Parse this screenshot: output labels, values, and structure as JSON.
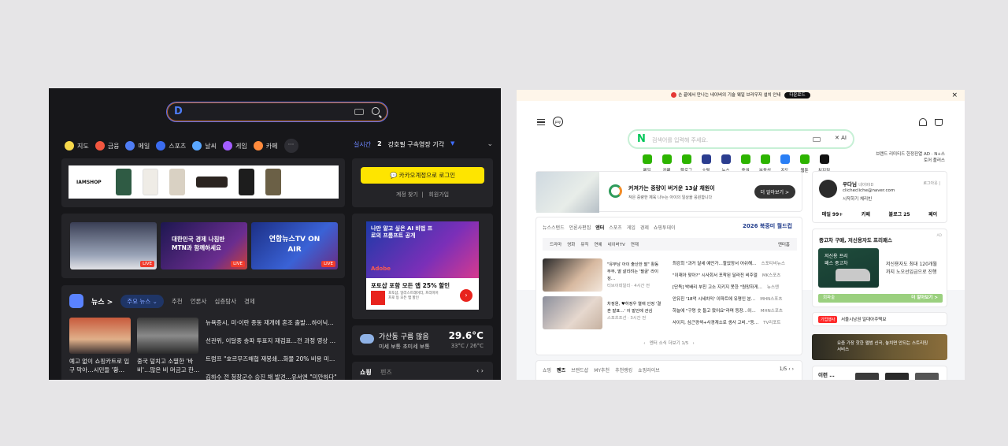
{
  "daum": {
    "search": {
      "placeholder": ""
    },
    "categories": [
      {
        "label": "지도",
        "color": "#f6d84b",
        "icon": "map-icon"
      },
      {
        "label": "금융",
        "color": "#f2563f",
        "icon": "finance-icon"
      },
      {
        "label": "메일",
        "color": "#4f7df5",
        "icon": "mail-icon"
      },
      {
        "label": "스포츠",
        "color": "#3b6cf0",
        "icon": "sports-icon"
      },
      {
        "label": "날씨",
        "color": "#5aa7ff",
        "icon": "weather-icon"
      },
      {
        "label": "게임",
        "color": "#a35dff",
        "icon": "game-icon"
      },
      {
        "label": "카페",
        "color": "#ff8a3c",
        "icon": "cafe-icon"
      }
    ],
    "more_label": "···",
    "realtime": {
      "label": "실시간",
      "rank": "2",
      "keyword": "강호필 구속영장 기각",
      "trend": "▼"
    },
    "ad_brand": "IAMSHOP",
    "login": {
      "button": "카카오계정으로 로그인",
      "find": "계정 찾기",
      "signup": "회원가입"
    },
    "videos": [
      {
        "live": "LIVE",
        "title": ""
      },
      {
        "live": "LIVE",
        "title": "대한민국 경제 나침반 MTN과 함께하세요"
      },
      {
        "live": "LIVE",
        "title": "연합뉴스TV ON AIR"
      }
    ],
    "side_ad": {
      "headline": "나만 알고 싶은 AI 비법 프로의 프롬프트 공개",
      "brand": "Adobe",
      "offer": "포토샵 포함 모든 앱 25% 할인",
      "detail": "포토샵, 일러스트레이터, 프리미어 프로 등 모든 앱 할인"
    },
    "news": {
      "section": "뉴스 >",
      "tabs": [
        "주요 뉴스",
        "추천",
        "언론사",
        "심층탐사",
        "경제"
      ],
      "thumb_caps": [
        "예고 없이 쇼핑카트로 입구 막아…시민들 '황…",
        "중국 덮치고 소멸한 '바비'…많은 비 머금고 한…"
      ],
      "headlines": [
        "뉴욕증시, 미·이란 종동 재개에 혼조 출발…하이닉…",
        "선관위, 이달중 송파 투표지 재검표…전 과정 영상 …",
        "트럼프 \"호르무즈해협 재봉쇄…화물 20% 비용 미…",
        "김하수 전 청장군수 승진 채 발견…유서엔 \"미안하다\""
      ]
    },
    "weather": {
      "location": "가산동 구름 많음",
      "dust": "미세 보통   초미세 보통",
      "temp": "29.6°C",
      "range": "33°C / 26°C"
    },
    "shop": {
      "label": "쇼핑",
      "sub": "펜즈",
      "nav": "‹  ›"
    }
  },
  "naver": {
    "banner": {
      "text": "손 끝에서 만나는 네이버의 기술 웨일 브라우저 설치 안내",
      "download": "다운로드",
      "close": "×"
    },
    "search": {
      "placeholder": "검색어를 입력해 주세요.",
      "ai": "✕ AI"
    },
    "services": [
      {
        "label": "메일",
        "color": "#2db400"
      },
      {
        "label": "카페",
        "color": "#2db400"
      },
      {
        "label": "블로그",
        "color": "#2db400"
      },
      {
        "label": "쇼핑",
        "color": "#2b3d8f"
      },
      {
        "label": "뉴스",
        "color": "#2b3d8f"
      },
      {
        "label": "증권",
        "color": "#2db400"
      },
      {
        "label": "부동산",
        "color": "#2db400"
      },
      {
        "label": "지도",
        "color": "#2a7ff5"
      },
      {
        "label": "웹툰",
        "color": "#2db400"
      },
      {
        "label": "치지직",
        "color": "#111111"
      }
    ],
    "promo": "브랜드 리미티드 한정진열 AD · N+스토어 플러스",
    "ad": {
      "title": "커져가는 중량이 버거운 13살 채원이",
      "desc": "작은 중량한 체육 나누는 아이의 일상을 응원합니다",
      "button": "더 알아보기 >"
    },
    "user": {
      "name": "우다님",
      "tag": "네이버ID",
      "email": "clichecliche@naver.com",
      "status": "시작하기   체리빈",
      "logout": "로그아웃 |",
      "stats": [
        "메일 99+",
        "카페",
        "블로그 25",
        "페이"
      ]
    },
    "news": {
      "tabs": [
        "뉴스스탠드",
        "언론사편집",
        "엔터",
        "스포츠",
        "게임",
        "경제",
        "쇼핑투데이"
      ],
      "wc": "2026 북중미 월드컵",
      "sub": [
        "드라마",
        "영화",
        "뮤직",
        "연예",
        "네이버TV",
        "연재"
      ],
      "sub_right": "엔터홈",
      "items": [
        {
          "title": "\"유부남 아이 출산한 딸\" 활동 부부, 딸 살리려는 '필굴' 라이징…",
          "meta": "티브이데일리 · 4시간 전"
        },
        {
          "title": "차정원, ♥하정우 열애 인정 '결혼 발표…' 이 발언에 관심",
          "meta": "스포츠조선 · 3시간 전"
        }
      ],
      "side": [
        {
          "t": "최강희 \"과거 달세 예언가…할었장서 어쉬해…",
          "s": "스포티비뉴스"
        },
        {
          "t": "\"이재아 맞아?\" 시사회서 포착된 달라진 비주얼",
          "s": "MK스포츠"
        },
        {
          "t": "[단독] 박배리 부친 고소 지키지 못한 \"원망하게…",
          "s": "뉴스엔"
        },
        {
          "t": "안유진 '18억 시세차익' 이파트에 유명인 분…",
          "s": "MHN스포츠"
        },
        {
          "t": "하늘에 \"구멍 숫 들고 왔어요\"라며 등장…이…",
          "s": "MHN스포츠"
        },
        {
          "t": "사이지, 심근경색+사경계소로 생사 고비..\"등…",
          "s": "TV리포트"
        }
      ],
      "pager": "엔터 소식 더보기 1/5"
    },
    "shop": {
      "tabs": [
        "쇼핑",
        "펜즈",
        "브랜드샵",
        "MY추천",
        "추천랭킹",
        "쇼핑라이브"
      ],
      "page": "1/5  ‹  ›"
    },
    "used": {
      "title": "중고차 구매, 저신용자도 프리패스",
      "ad": "AD",
      "img_text": "저신용 프리패스 중고차",
      "copy": "저신용자도 최대 120개월 까지 노오선입금으로 진행",
      "bar_left": "회파출",
      "bar_right": "더 알아보기 >"
    },
    "live": {
      "badge": "기업행사",
      "text": "서울시남권 일대아주택보"
    },
    "music": {
      "text": "요즘 가장 핫한 앨범 신곡, 놓치면 안되는 스트리밍 서비스",
      "highlight": "스트리밍 서비스"
    },
    "prod": {
      "title": "이런 …"
    }
  }
}
